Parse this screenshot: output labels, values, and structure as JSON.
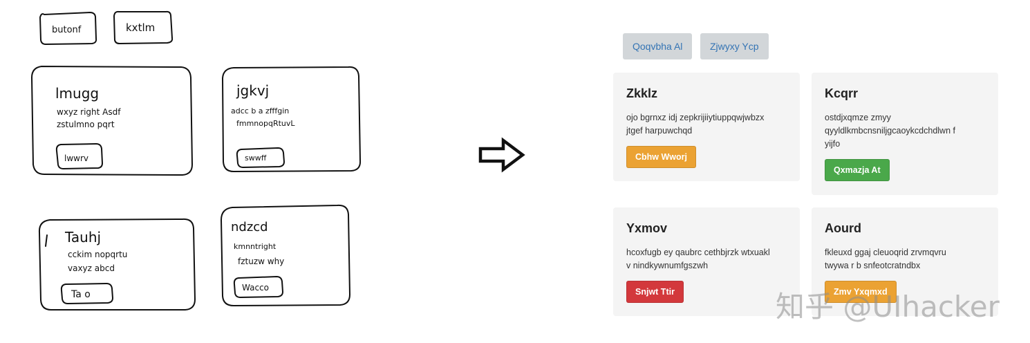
{
  "sketch": {
    "top_buttons": [
      "butonf",
      "kxtlm"
    ],
    "cards": [
      {
        "title": "lmugg",
        "lines": [
          "wxyz right Asdf",
          "zstulmno pqrt"
        ],
        "button": "lwwrv"
      },
      {
        "title": "jgkvj",
        "lines": [
          "adcc b a zfffgin",
          "fmmnopqRtuvL"
        ],
        "button": "swwff"
      },
      {
        "title": "Tauhj",
        "lines": [
          "cckim nopqrtu",
          "vaxyz abcd"
        ],
        "button": "Ta o"
      },
      {
        "title": "ndzcd",
        "lines": [
          "kmnntright",
          "fztuzw why"
        ],
        "button": "Wacco"
      }
    ]
  },
  "render": {
    "top_buttons": [
      "Qoqvbha Al",
      "Zjwyxy Ycp"
    ],
    "cards": [
      {
        "title": "Zkklz",
        "lines": [
          "ojo bgrnxz idj zepkrijiiytiuppqwjwbzx",
          "jtgef harpuwchqd"
        ],
        "button": "Cbhw Wworj",
        "button_color": "#eba233"
      },
      {
        "title": "Kcqrr",
        "lines": [
          "ostdjxqmze zmyy",
          "qyyldlkmbcnsniljgcaoykcdchdlwn f",
          "yijfo"
        ],
        "button": "Qxmazja At",
        "button_color": "#4aa84a"
      },
      {
        "title": "Yxmov",
        "lines": [
          "hcoxfugb ey qaubrc cethbjrzk wtxuakl",
          "v nindkywnumfgszwh"
        ],
        "button": "Snjwt Ttir",
        "button_color": "#d3383c"
      },
      {
        "title": "Aourd",
        "lines": [
          "fkleuxd ggaj cleuoqrid zrvmqvru",
          "twywa r b snfeotcratndbx"
        ],
        "button": "Zmv Yxqmxd",
        "button_color": "#eba233"
      }
    ]
  },
  "watermark": "知乎 @UIhacker"
}
